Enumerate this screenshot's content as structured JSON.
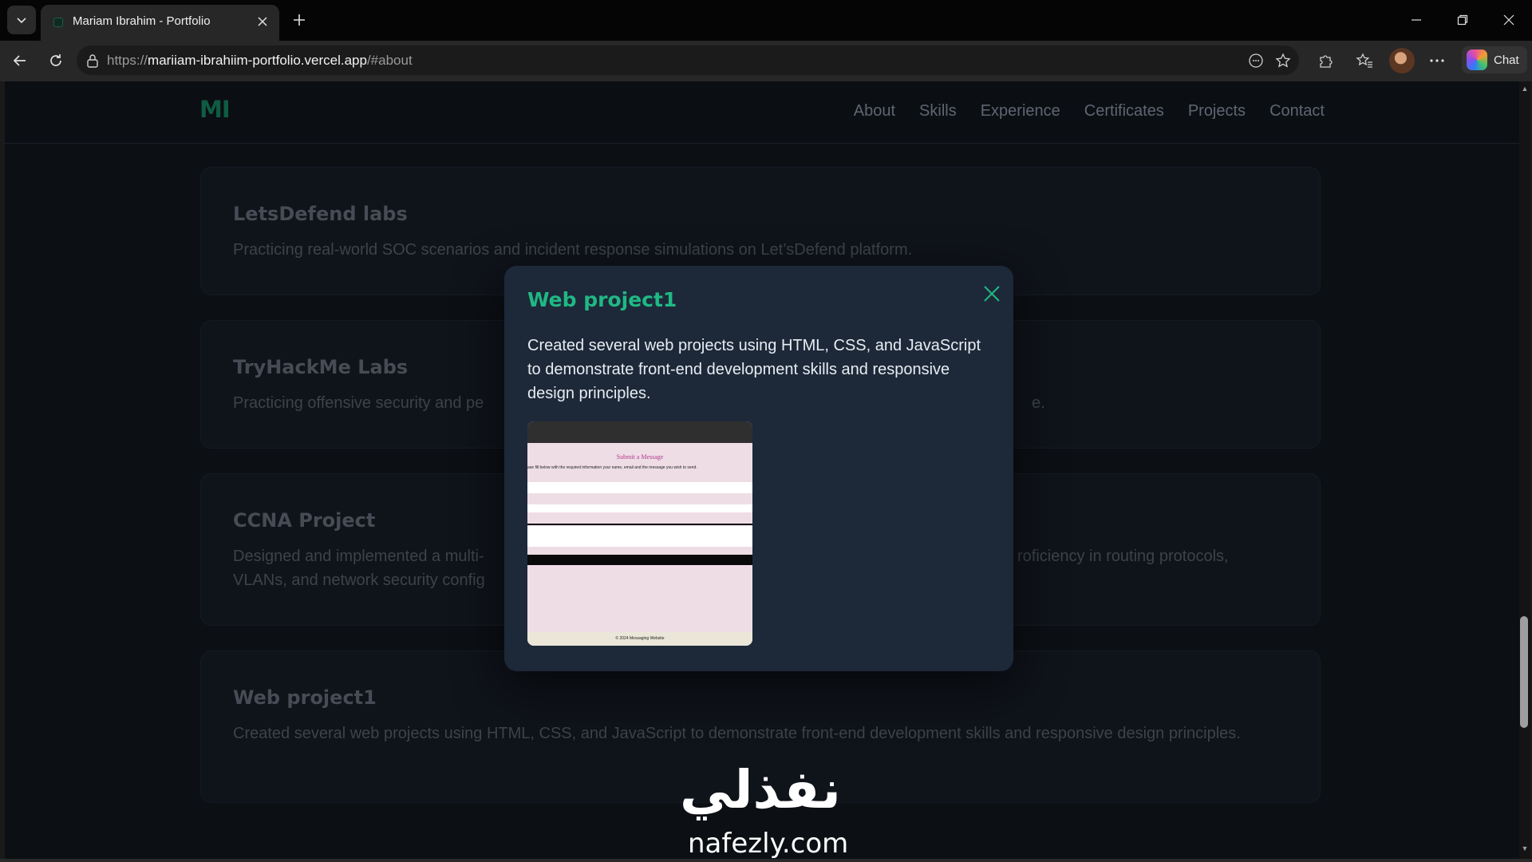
{
  "browser": {
    "tab_title": "Mariam Ibrahim - Portfolio",
    "url_scheme": "https://",
    "url_host": "mariiam-ibrahiim-portfolio.vercel.app",
    "url_path": "/#about",
    "chat_label": "Chat"
  },
  "site": {
    "logo": "MI",
    "nav": [
      "About",
      "Skills",
      "Experience",
      "Certificates",
      "Projects",
      "Contact"
    ]
  },
  "cards": [
    {
      "title": "LetsDefend labs",
      "desc": "Practicing real-world SOC scenarios and incident response simulations on Let’sDefend platform."
    },
    {
      "title": "TryHackMe Labs",
      "desc_left": "Practicing offensive security and pe",
      "desc_right": "e."
    },
    {
      "title": "CCNA Project",
      "desc_left": "Designed and implemented a multi-",
      "desc_right": "roficiency in routing protocols,",
      "desc_line2": "VLANs, and network security config"
    },
    {
      "title": "Web project1",
      "desc": "Created several web projects using HTML, CSS, and JavaScript to demonstrate front-end development skills and responsive design principles."
    }
  ],
  "modal": {
    "title": "Web project1",
    "description": "Created several web projects using HTML, CSS, and JavaScript to demonstrate front-end development skills and responsive design principles.",
    "preview": {
      "heading": "Submit a Message",
      "subtext": "ase fill below with the required information your name, email and the message you wish to send.",
      "footer": "© 2024 Messaging Website"
    }
  },
  "watermark": {
    "arabic": "نفذلي",
    "latin": "nafezly.com"
  },
  "colors": {
    "accent": "#20b884",
    "modal_bg": "#1d2939",
    "page_bg": "#0c0f14"
  }
}
